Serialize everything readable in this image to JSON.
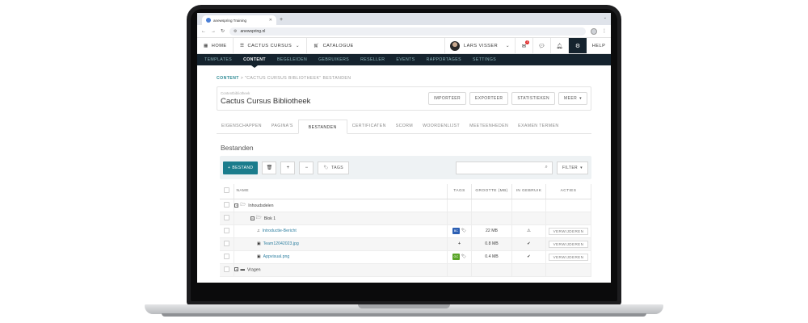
{
  "browser": {
    "tab_title": "anewspring Training",
    "url": "anewspring.nl"
  },
  "header": {
    "home": "HOME",
    "course": "CACTUS CURSUS",
    "catalogue": "CATALOGUE",
    "user": "LARS VISSER",
    "notification_count": "3",
    "help": "HELP"
  },
  "subnav": [
    "TEMPLATES",
    "CONTENT",
    "BEGELEIDEN",
    "GEBRUIKERS",
    "RESELLER",
    "EVENTS",
    "RAPPORTAGES",
    "SETTINGS"
  ],
  "breadcrumb": {
    "root": "CONTENT",
    "sep": " > ",
    "current": "\"CACTUS CURSUS BIBLIOTHEEK\" BESTANDEN"
  },
  "library": {
    "label": "Contentbibliotheek",
    "title": "Cactus Cursus Bibliotheek",
    "buttons": [
      "IMPORTEER",
      "EXPORTEER",
      "STATISTIEKEN",
      "MEER"
    ]
  },
  "tabs": [
    "EIGENSCHAPPEN",
    "PAGINA'S",
    "BESTANDEN",
    "CERTIFICATEN",
    "SCORM",
    "WOORDENLIJST",
    "MEETEENHEDEN",
    "EXAMEN TERMEN"
  ],
  "section_title": "Bestanden",
  "toolbar": {
    "add_file": "BESTAND",
    "tags": "TAGS",
    "filter": "FILTER"
  },
  "table": {
    "headers": [
      "NAME",
      "TAGS",
      "GROOTTE (MB)",
      "IN GEBRUIK",
      "ACTIES"
    ],
    "rows": [
      {
        "name": "Inhoudsdelen",
        "kind": "folder",
        "level": 0,
        "toggle": "−"
      },
      {
        "name": "Blok 1",
        "kind": "folder",
        "level": 1,
        "toggle": "−"
      },
      {
        "name": "Introductie-Bericht",
        "kind": "audio",
        "level": 2,
        "tag": "BC",
        "tag_color": "#2c5fb3",
        "size": "22 MB",
        "in_use": "warning",
        "action": "VERWIJDEREN"
      },
      {
        "name": "Team12042023.jpg",
        "kind": "image",
        "level": 2,
        "tag": "+",
        "size": "0.8 MB",
        "in_use": "check",
        "action": "VERWIJDEREN"
      },
      {
        "name": "Appvisual.png",
        "kind": "image",
        "level": 2,
        "tag": "GC",
        "tag_color": "#5aa528",
        "size": "0.4 MB",
        "in_use": "check",
        "action": "VERWIJDEREN"
      },
      {
        "name": "Vragen",
        "kind": "folder",
        "level": 0,
        "toggle": "+"
      }
    ]
  }
}
